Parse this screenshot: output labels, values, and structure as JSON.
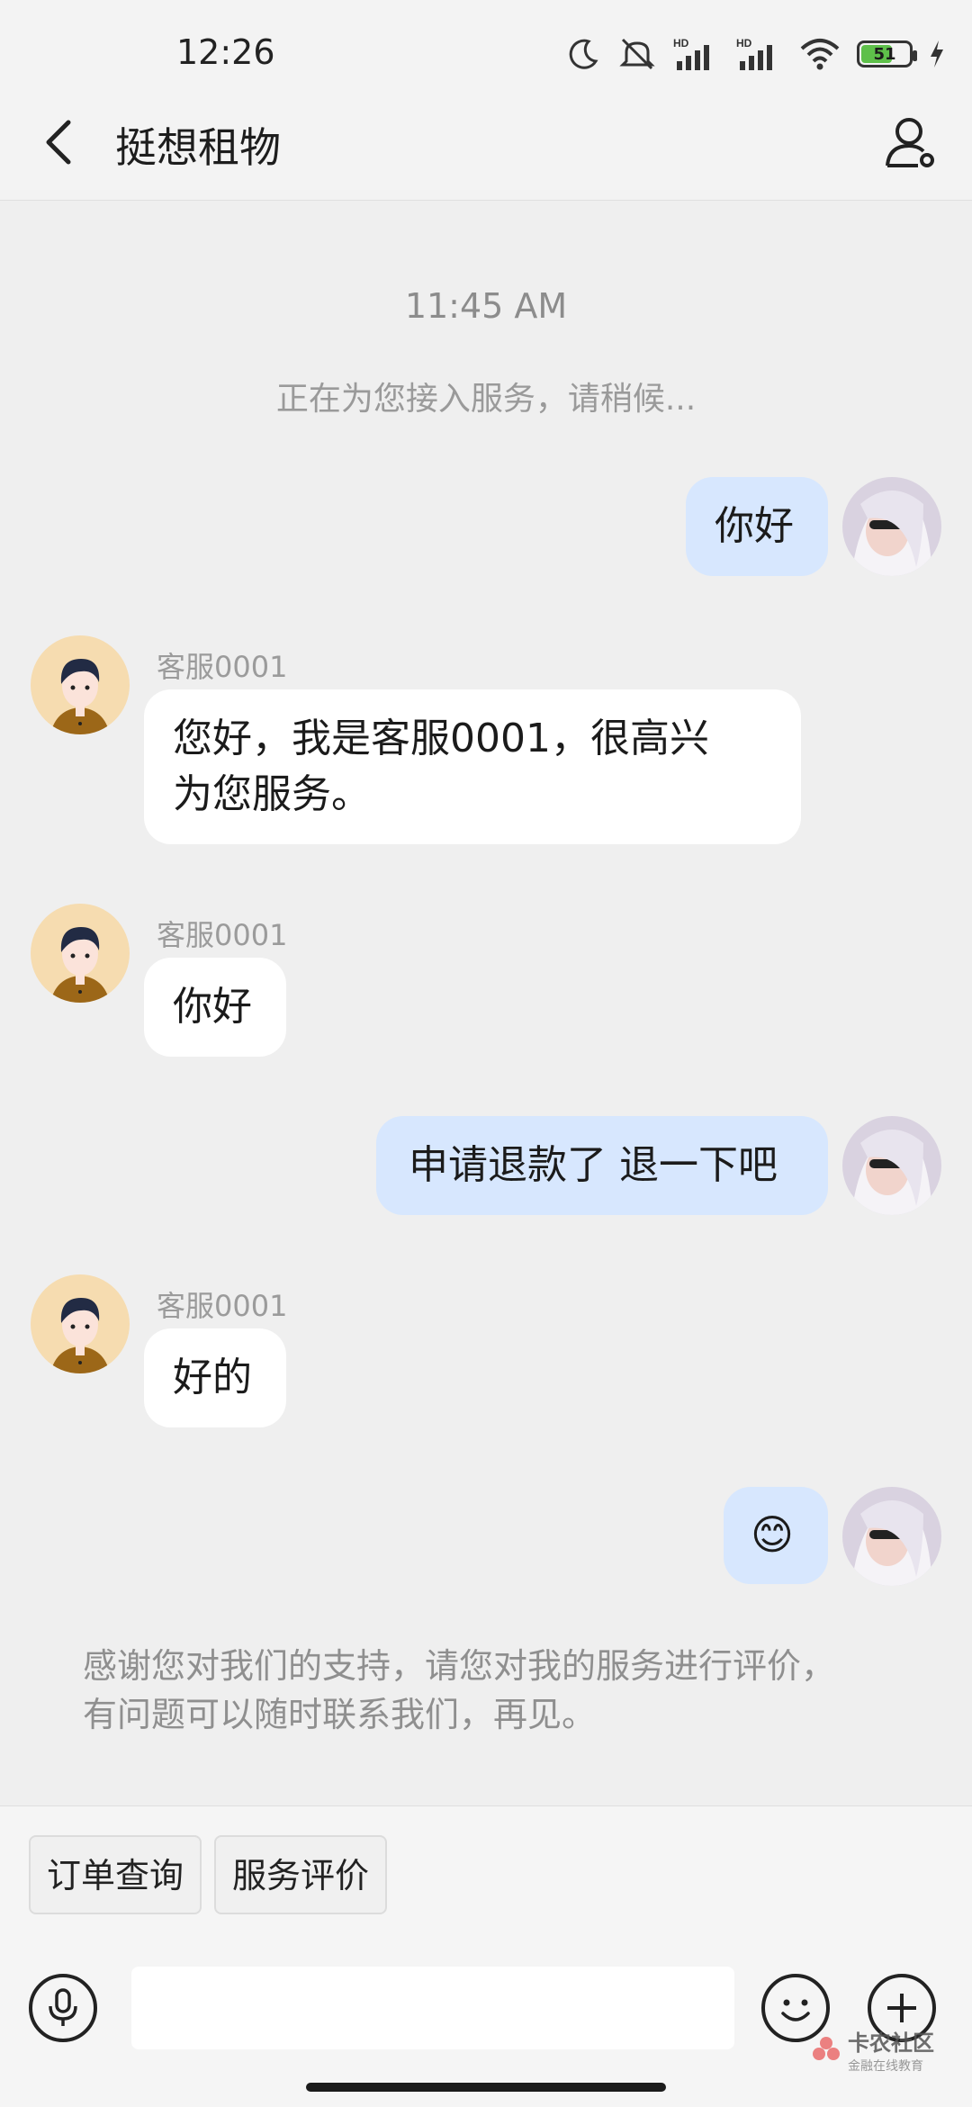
{
  "status_bar": {
    "time": "12:26",
    "battery": "51",
    "icons": [
      "moon-icon",
      "mute-icon",
      "signal-hd-icon",
      "signal-hd-icon",
      "wifi-icon",
      "battery-icon",
      "charging-icon"
    ]
  },
  "header": {
    "title": "挺想租物",
    "back_icon": "chevron-left-icon",
    "profile_icon": "user-settings-icon"
  },
  "chat": {
    "timestamp": "11:45 AM",
    "system_note": "正在为您接入服务，请稍候...",
    "messages": [
      {
        "from": "me",
        "text": "你好"
      },
      {
        "from": "agent",
        "sender": "客服0001",
        "line1": "您好，我是客服0001，很高兴",
        "line2": "为您服务。"
      },
      {
        "from": "agent",
        "sender": "客服0001",
        "text": "你好"
      },
      {
        "from": "me",
        "text": "申请退款了 退一下吧"
      },
      {
        "from": "agent",
        "sender": "客服0001",
        "text": "好的"
      },
      {
        "from": "me",
        "text": "😊"
      }
    ],
    "closing_line1": "感谢您对我们的支持，请您对我的服务进行评价，",
    "closing_line2": "有问题可以随时联系我们，再见。"
  },
  "quick_actions": [
    "订单查询",
    "服务评价"
  ],
  "input": {
    "value": "",
    "placeholder": ""
  },
  "watermark": {
    "main": "卡农社区",
    "sub": "金融在线教育"
  },
  "colors": {
    "my_bubble": "#d7e7fe",
    "agent_bubble": "#ffffff",
    "background": "#efefef"
  }
}
